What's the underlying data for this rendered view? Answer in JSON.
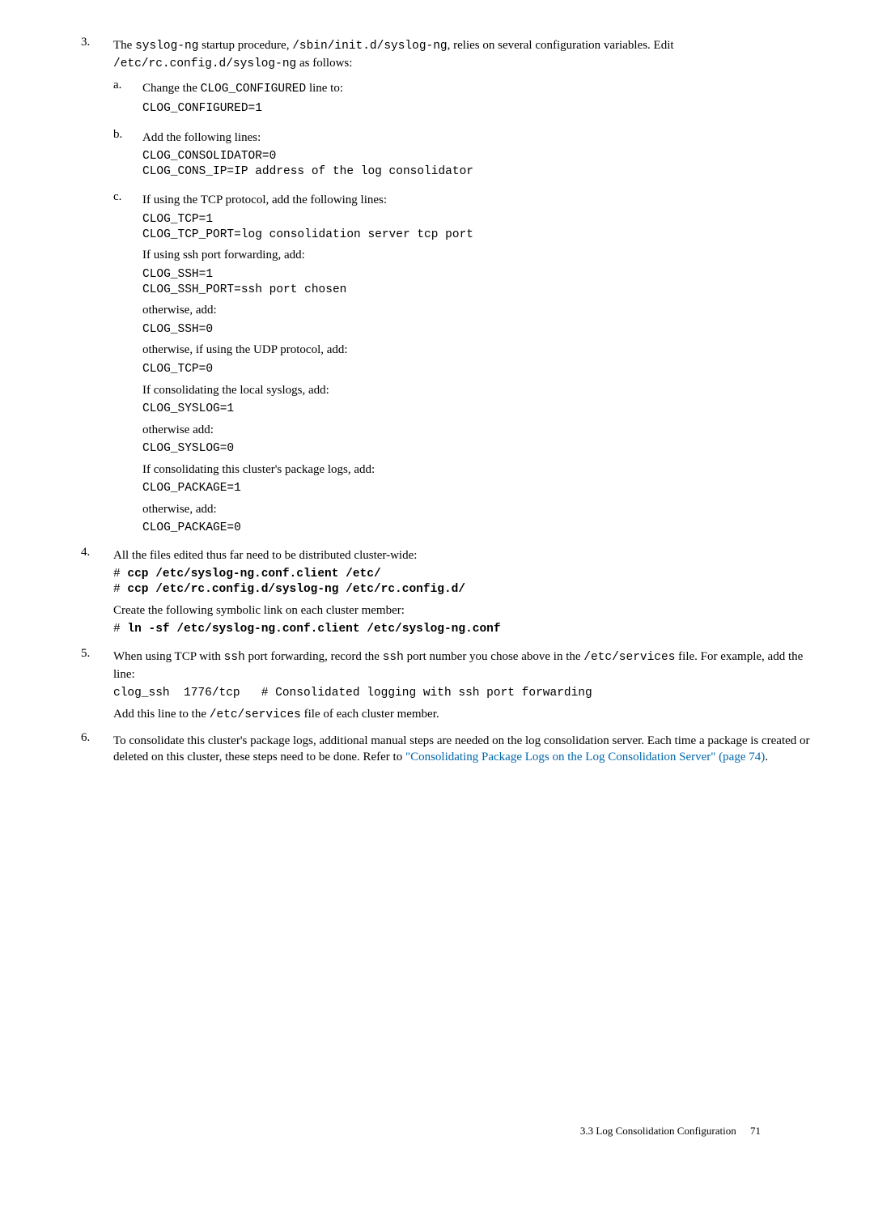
{
  "items": {
    "n3": {
      "num": "3.",
      "intro_a": "The ",
      "intro_b": " startup procedure, ",
      "intro_c": ", relies on several configuration variables. Edit ",
      "intro_d": " as follows:",
      "code1": "syslog-ng",
      "code2": "/sbin/init.d/syslog-ng",
      "code3": "/etc/rc.config.d/syslog-ng",
      "a": {
        "num": "a.",
        "text_a": "Change the ",
        "text_b": " line to:",
        "code_inline": "CLOG_CONFIGURED",
        "pre": "CLOG_CONFIGURED=1"
      },
      "b": {
        "num": "b.",
        "text": "Add the following lines:",
        "pre": "CLOG_CONSOLIDATOR=0\nCLOG_CONS_IP=IP address of the log consolidator"
      },
      "c": {
        "num": "c.",
        "p1": "If using the TCP protocol, add the following lines:",
        "pre1": "CLOG_TCP=1\nCLOG_TCP_PORT=log consolidation server tcp port",
        "p2": "If using ssh port forwarding, add:",
        "pre2": "CLOG_SSH=1\nCLOG_SSH_PORT=ssh port chosen",
        "p3": "otherwise, add:",
        "pre3": "CLOG_SSH=0",
        "p4": "otherwise, if using the UDP protocol, add:",
        "pre4": "CLOG_TCP=0",
        "p5": "If consolidating the local syslogs, add:",
        "pre5": "CLOG_SYSLOG=1",
        "p6": "otherwise add:",
        "pre6": "CLOG_SYSLOG=0",
        "p7": "If consolidating this cluster's package logs, add:",
        "pre7": "CLOG_PACKAGE=1",
        "p8": "otherwise, add:",
        "pre8": "CLOG_PACKAGE=0"
      }
    },
    "n4": {
      "num": "4.",
      "p1": "All the files edited thus far need to be distributed cluster-wide:",
      "pre1_prefix1": "# ",
      "pre1_bold1": "ccp /etc/syslog-ng.conf.client /etc/",
      "pre1_prefix2": "# ",
      "pre1_bold2": "ccp /etc/rc.config.d/syslog-ng /etc/rc.config.d/",
      "p2": "Create the following symbolic link on each cluster member:",
      "pre2_prefix": "# ",
      "pre2_bold": "ln -sf /etc/syslog-ng.conf.client /etc/syslog-ng.conf"
    },
    "n5": {
      "num": "5.",
      "p1_a": "When using TCP with ",
      "p1_b": " port forwarding, record the ",
      "p1_c": " port number you chose above in the ",
      "p1_d": " file. For example, add the line:",
      "code_ssh": "ssh",
      "code_file": "/etc/services",
      "pre": "clog_ssh  1776/tcp   # Consolidated logging with ssh port forwarding",
      "p2_a": "Add this line to the ",
      "p2_b": " file of each cluster member.",
      "code_file2": "/etc/services"
    },
    "n6": {
      "num": "6.",
      "p_a": "To consolidate this cluster's package logs, additional manual steps are needed on the log consolidation server. Each time a package is created or deleted on this cluster, these steps need to be done. Refer to ",
      "link": "\"Consolidating Package Logs on the Log Consolidation Server\" (page 74)",
      "p_b": "."
    }
  },
  "footer": {
    "section": "3.3 Log Consolidation Configuration",
    "page": "71"
  }
}
